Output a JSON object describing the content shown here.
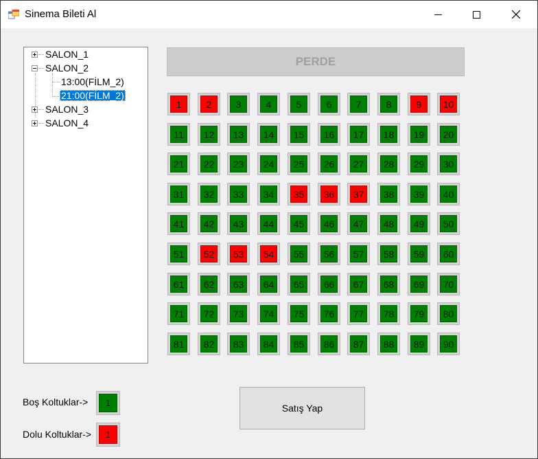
{
  "window": {
    "title": "Sinema Bileti Al",
    "icons": {
      "app": "app-window-icon",
      "minimize": "minimize-icon",
      "maximize": "maximize-icon",
      "close": "close-icon"
    }
  },
  "tree": {
    "nodes": [
      {
        "label": "SALON_1",
        "expanded": false
      },
      {
        "label": "SALON_2",
        "expanded": true,
        "children": [
          {
            "label": "13:00(FİLM_2)",
            "selected": false
          },
          {
            "label": "21:00(FİLM_2)",
            "selected": true
          }
        ]
      },
      {
        "label": "SALON_3",
        "expanded": false
      },
      {
        "label": "SALON_4",
        "expanded": false
      }
    ]
  },
  "screen_label": "PERDE",
  "colors": {
    "empty": "#008000",
    "occupied": "#ff0000"
  },
  "seats": [
    {
      "n": "1",
      "taken": true
    },
    {
      "n": "2",
      "taken": true
    },
    {
      "n": "3",
      "taken": false
    },
    {
      "n": "4",
      "taken": false
    },
    {
      "n": "5",
      "taken": false
    },
    {
      "n": "6",
      "taken": false
    },
    {
      "n": "7",
      "taken": false
    },
    {
      "n": "8",
      "taken": false
    },
    {
      "n": "9",
      "taken": true
    },
    {
      "n": "10",
      "taken": true
    },
    {
      "n": "11",
      "taken": false
    },
    {
      "n": "12",
      "taken": false
    },
    {
      "n": "13",
      "taken": false
    },
    {
      "n": "14",
      "taken": false
    },
    {
      "n": "15",
      "taken": false
    },
    {
      "n": "16",
      "taken": false
    },
    {
      "n": "17",
      "taken": false
    },
    {
      "n": "18",
      "taken": false
    },
    {
      "n": "19",
      "taken": false
    },
    {
      "n": "20",
      "taken": false
    },
    {
      "n": "21",
      "taken": false
    },
    {
      "n": "22",
      "taken": false
    },
    {
      "n": "23",
      "taken": false
    },
    {
      "n": "24",
      "taken": false
    },
    {
      "n": "25",
      "taken": false
    },
    {
      "n": "26",
      "taken": false
    },
    {
      "n": "27",
      "taken": false
    },
    {
      "n": "28",
      "taken": false
    },
    {
      "n": "29",
      "taken": false
    },
    {
      "n": "30",
      "taken": false
    },
    {
      "n": "31",
      "taken": false
    },
    {
      "n": "32",
      "taken": false
    },
    {
      "n": "33",
      "taken": false
    },
    {
      "n": "34",
      "taken": false
    },
    {
      "n": "35",
      "taken": true
    },
    {
      "n": "36",
      "taken": true
    },
    {
      "n": "37",
      "taken": true
    },
    {
      "n": "38",
      "taken": false
    },
    {
      "n": "39",
      "taken": false
    },
    {
      "n": "40",
      "taken": false
    },
    {
      "n": "41",
      "taken": false
    },
    {
      "n": "42",
      "taken": false
    },
    {
      "n": "43",
      "taken": false
    },
    {
      "n": "44",
      "taken": false
    },
    {
      "n": "45",
      "taken": false
    },
    {
      "n": "46",
      "taken": false
    },
    {
      "n": "47",
      "taken": false
    },
    {
      "n": "48",
      "taken": false
    },
    {
      "n": "49",
      "taken": false
    },
    {
      "n": "50",
      "taken": false
    },
    {
      "n": "51",
      "taken": false
    },
    {
      "n": "52",
      "taken": true
    },
    {
      "n": "53",
      "taken": true
    },
    {
      "n": "54",
      "taken": true
    },
    {
      "n": "55",
      "taken": false
    },
    {
      "n": "56",
      "taken": false
    },
    {
      "n": "57",
      "taken": false
    },
    {
      "n": "58",
      "taken": false
    },
    {
      "n": "59",
      "taken": false
    },
    {
      "n": "60",
      "taken": false
    },
    {
      "n": "61",
      "taken": false
    },
    {
      "n": "62",
      "taken": false
    },
    {
      "n": "63",
      "taken": false
    },
    {
      "n": "64",
      "taken": false
    },
    {
      "n": "65",
      "taken": false
    },
    {
      "n": "66",
      "taken": false
    },
    {
      "n": "67",
      "taken": false
    },
    {
      "n": "68",
      "taken": false
    },
    {
      "n": "69",
      "taken": false
    },
    {
      "n": "70",
      "taken": false
    },
    {
      "n": "71",
      "taken": false
    },
    {
      "n": "72",
      "taken": false
    },
    {
      "n": "73",
      "taken": false
    },
    {
      "n": "74",
      "taken": false
    },
    {
      "n": "75",
      "taken": false
    },
    {
      "n": "76",
      "taken": false
    },
    {
      "n": "77",
      "taken": false
    },
    {
      "n": "78",
      "taken": false
    },
    {
      "n": "79",
      "taken": false
    },
    {
      "n": "80",
      "taken": false
    },
    {
      "n": "81",
      "taken": false
    },
    {
      "n": "82",
      "taken": false
    },
    {
      "n": "83",
      "taken": false
    },
    {
      "n": "84",
      "taken": false
    },
    {
      "n": "85",
      "taken": false
    },
    {
      "n": "86",
      "taken": false
    },
    {
      "n": "87",
      "taken": false
    },
    {
      "n": "88",
      "taken": false
    },
    {
      "n": "89",
      "taken": false
    },
    {
      "n": "90",
      "taken": false
    }
  ],
  "legend": {
    "empty_label": "Boş Koltuklar->",
    "empty_value": "1",
    "occupied_label": "Dolu Koltuklar->",
    "occupied_value": "1"
  },
  "actions": {
    "sell_label": "Satış Yap"
  }
}
